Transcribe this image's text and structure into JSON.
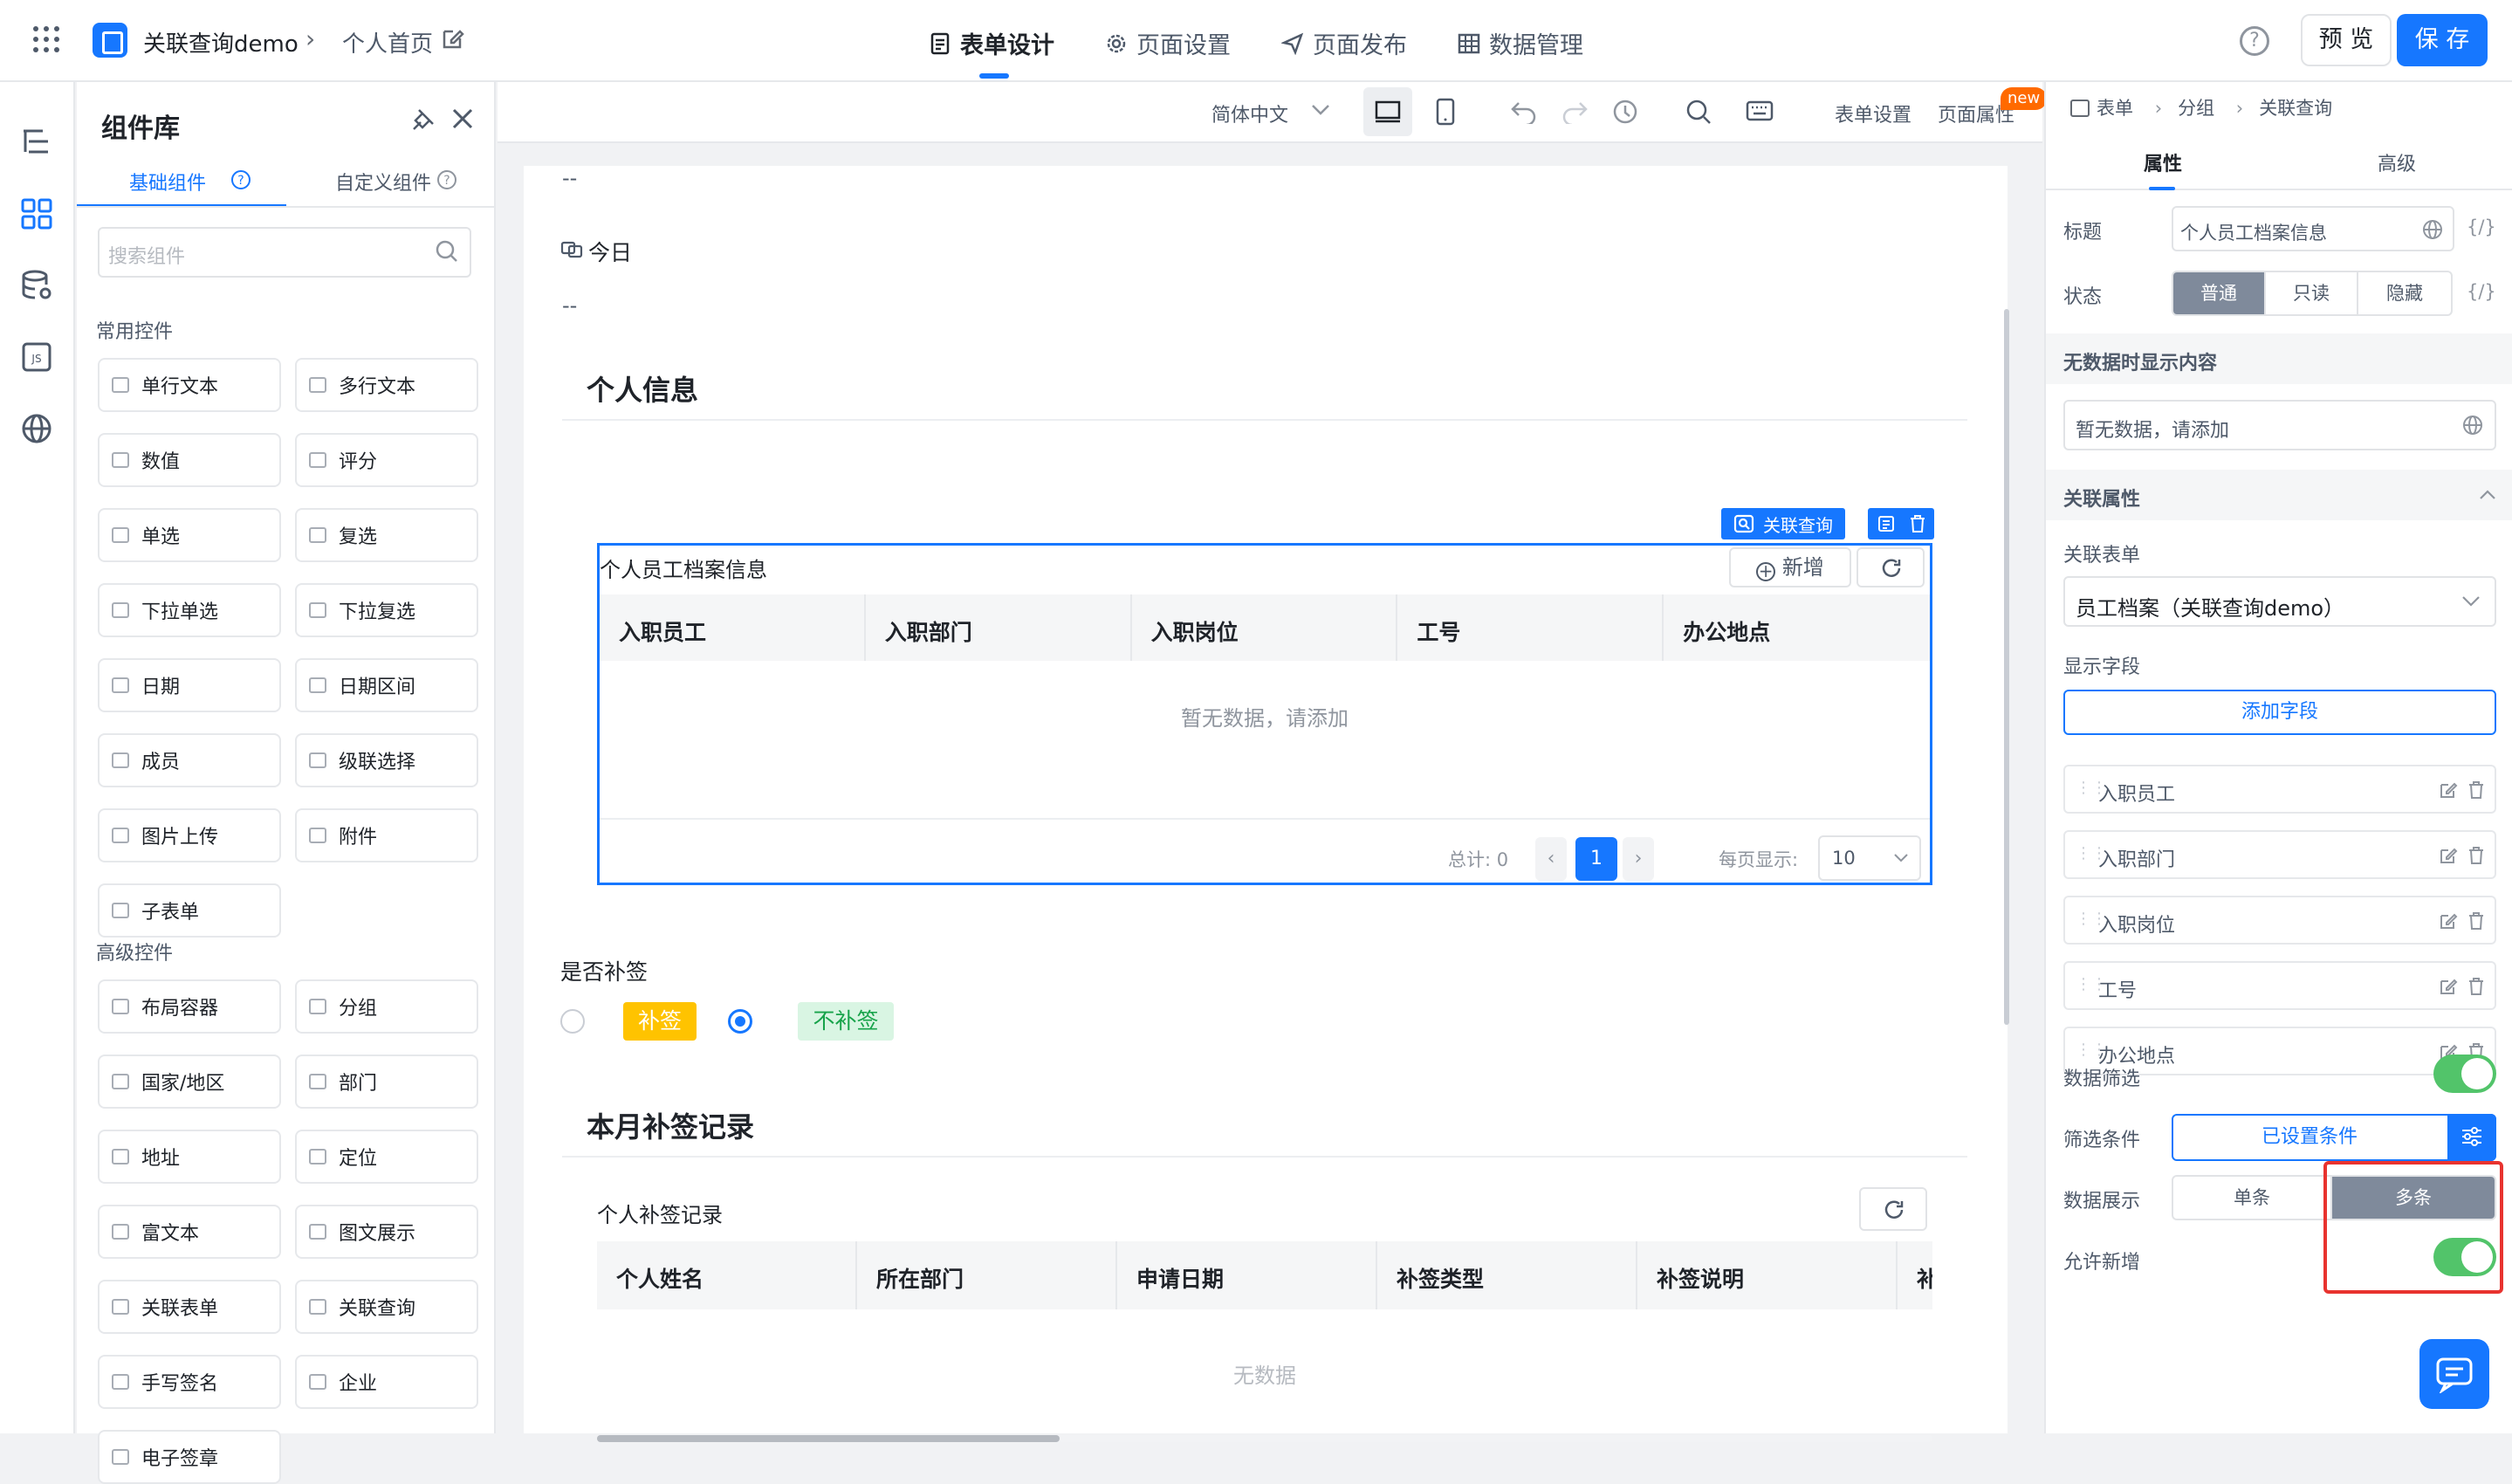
{
  "header": {
    "app_title": "关联查询demo",
    "page_name": "个人首页",
    "tabs": [
      {
        "label": "表单设计",
        "active": true
      },
      {
        "label": "页面设置"
      },
      {
        "label": "页面发布"
      },
      {
        "label": "数据管理"
      }
    ],
    "help": "?",
    "preview_label": "预 览",
    "save_label": "保 存",
    "accent": "#1677ff"
  },
  "library": {
    "title": "组件库",
    "tabs": [
      "基础组件",
      "自定义组件"
    ],
    "search_placeholder": "搜索组件",
    "common_title": "常用控件",
    "common": [
      "单行文本",
      "多行文本",
      "数值",
      "评分",
      "单选",
      "复选",
      "下拉单选",
      "下拉复选",
      "日期",
      "日期区间",
      "成员",
      "级联选择",
      "图片上传",
      "附件",
      "子表单"
    ],
    "advanced_title": "高级控件",
    "advanced": [
      "布局容器",
      "分组",
      "国家/地区",
      "部门",
      "地址",
      "定位",
      "富文本",
      "图文展示",
      "关联表单",
      "关联查询",
      "手写签名",
      "企业",
      "电子签章"
    ]
  },
  "toolbar": {
    "language": "简体中文",
    "form_settings": "表单设置",
    "page_props": "页面属性",
    "new_badge": "new"
  },
  "canvas": {
    "dash_top": "--",
    "today_label": "今日",
    "dash_bottom": "--",
    "section1_title": "个人信息",
    "selected_chip": "关联查询",
    "table1": {
      "title": "个人员工档案信息",
      "add_label": "新增",
      "columns": [
        "入职员工",
        "入职部门",
        "入职岗位",
        "工号",
        "办公地点"
      ],
      "empty_text": "暂无数据，请添加",
      "total": "总计: 0",
      "page": "1",
      "per_page_label": "每页显示:",
      "per_page": "10"
    },
    "radio_label": "是否补签",
    "radio_options": [
      "补签",
      "不补签"
    ],
    "radio_selected": "不补签",
    "section2_title": "本月补签记录",
    "table2": {
      "title": "个人补签记录",
      "columns": [
        "个人姓名",
        "所在部门",
        "申请日期",
        "补签类型",
        "补签说明",
        "补"
      ],
      "empty_text": "无数据"
    }
  },
  "props": {
    "breadcrumb": [
      "表单",
      "分组",
      "关联查询"
    ],
    "tabs": [
      "属性",
      "高级"
    ],
    "title_label": "标题",
    "title_value": "个人员工档案信息",
    "status_label": "状态",
    "status_options": [
      "普通",
      "只读",
      "隐藏"
    ],
    "status_selected": "普通",
    "code_icon": "{/}",
    "empty_group": "无数据时显示内容",
    "empty_value": "暂无数据，请添加",
    "relation_group": "关联属性",
    "rel_form_label": "关联表单",
    "rel_form_value": "员工档案（关联查询demo）",
    "display_fields_label": "显示字段",
    "add_field_label": "添加字段",
    "fields": [
      "入职员工",
      "入职部门",
      "入职岗位",
      "工号",
      "办公地点"
    ],
    "filter_label": "数据筛选",
    "filter_on": true,
    "cond_label": "筛选条件",
    "cond_value": "已设置条件",
    "display_label": "数据展示",
    "display_options": [
      "单条",
      "多条"
    ],
    "display_selected": "多条",
    "allow_add_label": "允许新增",
    "allow_add_on": true
  }
}
